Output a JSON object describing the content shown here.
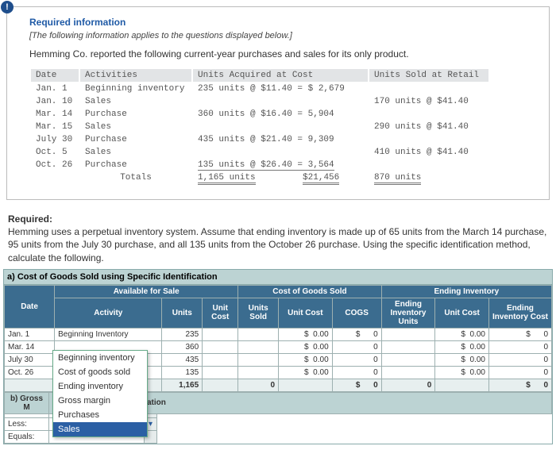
{
  "info": {
    "title": "Required information",
    "subtitle": "[The following information applies to the questions displayed below.]",
    "lead": "Hemming Co. reported the following current-year purchases and sales for its only product.",
    "headers": {
      "date": "Date",
      "act": "Activities",
      "acq": "Units Acquired at Cost",
      "sold": "Units Sold at Retail"
    },
    "rows": [
      {
        "date": "Jan.  1",
        "act": "Beginning inventory",
        "acq": "235 units @ $11.40  = $ 2,679",
        "sold": ""
      },
      {
        "date": "Jan. 10",
        "act": "Sales",
        "acq": "",
        "sold": "170 units @ $41.40"
      },
      {
        "date": "Mar. 14",
        "act": "Purchase",
        "acq": "360 units @ $16.40  =   5,904",
        "sold": ""
      },
      {
        "date": "Mar. 15",
        "act": "Sales",
        "acq": "",
        "sold": "290 units @ $41.40"
      },
      {
        "date": "July 30",
        "act": "Purchase",
        "acq": "435 units @ $21.40  =   9,309",
        "sold": ""
      },
      {
        "date": "Oct.  5",
        "act": "Sales",
        "acq": "",
        "sold": "410 units @ $41.40"
      },
      {
        "date": "Oct. 26",
        "act": "Purchase",
        "acq": "135 units @ $26.40  =   3,564",
        "sold": ""
      }
    ],
    "totals": {
      "label": "Totals",
      "units": "1,165 units",
      "cost": "$21,456",
      "sold": "870 units"
    }
  },
  "required": {
    "heading": "Required:",
    "body": "Hemming uses a perpetual inventory system. Assume that ending inventory is made up of 65 units from the March 14 purchase, 95 units from the July 30 purchase, and all 135 units from the October 26 purchase. Using the specific identification method, calculate the following."
  },
  "tableA": {
    "title": "a) Cost of Goods Sold using Specific Identification",
    "groups": {
      "af": "Available for Sale",
      "cogs": "Cost of Goods Sold",
      "end": "Ending Inventory"
    },
    "cols": {
      "date": "Date",
      "activity": "Activity",
      "units": "Units",
      "ucost": "Unit Cost",
      "usold": "Units Sold",
      "ucost2": "Unit Cost",
      "cogs": "COGS",
      "eunits": "Ending Inventory Units",
      "eucost": "Unit Cost",
      "ecost": "Ending Inventory Cost"
    },
    "rows": [
      {
        "date": "Jan. 1",
        "activity": "Beginning Inventory",
        "units": "235",
        "ucost": "",
        "usold": "",
        "ucostv": "0.00",
        "cogs": "0",
        "eunits": "",
        "eucost": "0.00",
        "ecost": "0"
      },
      {
        "date": "Mar. 14",
        "activity": "",
        "units": "360",
        "ucost": "",
        "usold": "",
        "ucostv": "0.00",
        "cogs": "0",
        "eunits": "",
        "eucost": "0.00",
        "ecost": "0"
      },
      {
        "date": "July 30",
        "activity": "",
        "units": "435",
        "ucost": "",
        "usold": "",
        "ucostv": "0.00",
        "cogs": "0",
        "eunits": "",
        "eucost": "0.00",
        "ecost": "0"
      },
      {
        "date": "Oct. 26",
        "activity": "",
        "units": "135",
        "ucost": "",
        "usold": "",
        "ucostv": "0.00",
        "cogs": "0",
        "eunits": "",
        "eucost": "0.00",
        "ecost": "0"
      }
    ],
    "total": {
      "units": "1,165",
      "usold": "0",
      "cogs": "0",
      "eunits": "0",
      "ecost": "0"
    },
    "dollar": "$"
  },
  "tableB": {
    "title_prefix": "b) Gross M",
    "title_suffix": "ation",
    "less": "Less:",
    "equals": "Equals:"
  },
  "dropdown": {
    "options": [
      "Beginning inventory",
      "Cost of goods sold",
      "Ending inventory",
      "Gross margin",
      "Purchases",
      "Sales"
    ],
    "selected": "Sales"
  }
}
